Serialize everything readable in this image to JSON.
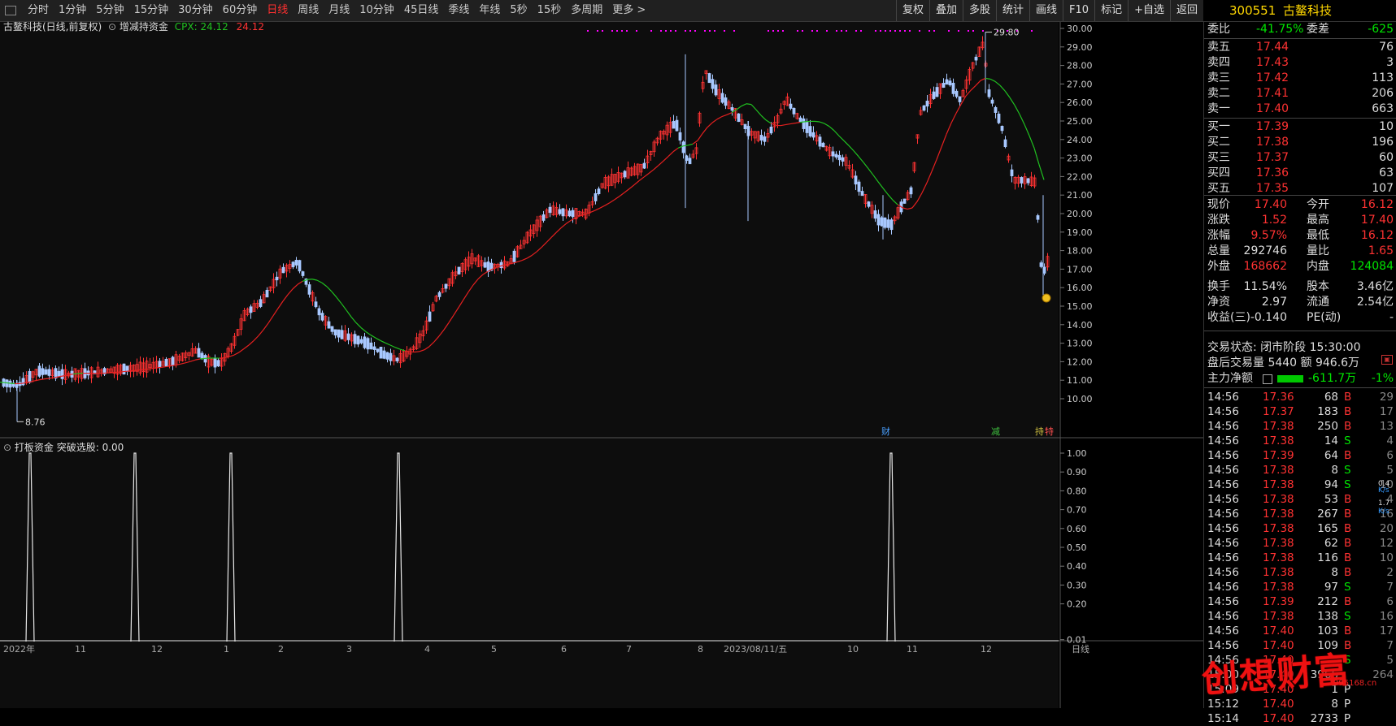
{
  "toolbar": {
    "periods": [
      "分时",
      "1分钟",
      "5分钟",
      "15分钟",
      "30分钟",
      "60分钟",
      "日线",
      "周线",
      "月线",
      "10分钟",
      "45日线",
      "季线",
      "年线",
      "5秒",
      "15秒",
      "多周期",
      "更多 >"
    ],
    "active_period": "日线",
    "tools": [
      "复权",
      "叠加",
      "多股",
      "统计",
      "画线",
      "F10",
      "标记",
      "+自选",
      "返回"
    ]
  },
  "main_pane": {
    "title": "古鳌科技(日线,前复权)",
    "indicator_name": "增减持资金",
    "cpx_label": "CPX: 24.12",
    "cpx_value": "24.12",
    "high_marker": "29.80",
    "low_marker": "8.76",
    "y_ticks": [
      "30.00",
      "29.00",
      "28.00",
      "27.00",
      "26.00",
      "25.00",
      "24.00",
      "23.00",
      "22.00",
      "21.00",
      "20.00",
      "19.00",
      "18.00",
      "17.00",
      "16.00",
      "15.00",
      "14.00",
      "13.00",
      "12.00",
      "11.00",
      "10.00"
    ],
    "event_tags": [
      "财",
      "减",
      "持",
      "特"
    ]
  },
  "sub_pane": {
    "title": "打板资金 突破选股: 0.00",
    "y_ticks": [
      "1.00",
      "0.90",
      "0.80",
      "0.70",
      "0.60",
      "0.50",
      "0.40",
      "0.30",
      "0.20",
      "0.01"
    ],
    "x_axis_labels": [
      "2022年",
      "11",
      "12",
      "1",
      "2",
      "3",
      "4",
      "5",
      "6",
      "7",
      "8",
      "2023/08/11/五",
      "10",
      "11",
      "12",
      "日线"
    ]
  },
  "stock": {
    "code": "300551",
    "name": "古鳌科技"
  },
  "order_book": {
    "weibi_label": "委比",
    "weibi_value": "-41.75%",
    "weicha_label": "委差",
    "weicha_value": "-625",
    "asks": [
      {
        "label": "卖五",
        "price": "17.44",
        "vol": "76"
      },
      {
        "label": "卖四",
        "price": "17.43",
        "vol": "3"
      },
      {
        "label": "卖三",
        "price": "17.42",
        "vol": "113"
      },
      {
        "label": "卖二",
        "price": "17.41",
        "vol": "206"
      },
      {
        "label": "卖一",
        "price": "17.40",
        "vol": "663"
      }
    ],
    "bids": [
      {
        "label": "买一",
        "price": "17.39",
        "vol": "10"
      },
      {
        "label": "买二",
        "price": "17.38",
        "vol": "196"
      },
      {
        "label": "买三",
        "price": "17.37",
        "vol": "60"
      },
      {
        "label": "买四",
        "price": "17.36",
        "vol": "63"
      },
      {
        "label": "买五",
        "price": "17.35",
        "vol": "107"
      }
    ]
  },
  "stats": [
    {
      "l1": "现价",
      "v1": "17.40",
      "c1": "red",
      "l2": "今开",
      "v2": "16.12",
      "c2": "red"
    },
    {
      "l1": "涨跌",
      "v1": "1.52",
      "c1": "red",
      "l2": "最高",
      "v2": "17.40",
      "c2": "red"
    },
    {
      "l1": "涨幅",
      "v1": "9.57%",
      "c1": "red",
      "l2": "最低",
      "v2": "16.12",
      "c2": "red"
    },
    {
      "l1": "总量",
      "v1": "292746",
      "c1": "white",
      "l2": "量比",
      "v2": "1.65",
      "c2": "red"
    },
    {
      "l1": "外盘",
      "v1": "168662",
      "c1": "red",
      "l2": "内盘",
      "v2": "124084",
      "c2": "green"
    },
    {
      "l1": "换手",
      "v1": "11.54%",
      "c1": "white",
      "l2": "股本",
      "v2": "3.46亿",
      "c2": "white"
    },
    {
      "l1": "净资",
      "v1": "2.97",
      "c1": "white",
      "l2": "流通",
      "v2": "2.54亿",
      "c2": "white"
    },
    {
      "l1": "收益(三)",
      "v1": "-0.140",
      "c1": "white",
      "l2": "PE(动)",
      "v2": "-",
      "c2": "white"
    }
  ],
  "status": {
    "trade_state": "交易状态: 闭市阶段 15:30:00",
    "after_hours": "盘后交易量 5440 额 946.6万",
    "main_net_label": "主力净额",
    "main_net_value": "-611.7万",
    "main_net_pct": "-1%"
  },
  "trades": [
    {
      "t": "14:56",
      "p": "17.36",
      "v": "68",
      "d": "B",
      "n": "29"
    },
    {
      "t": "14:56",
      "p": "17.37",
      "v": "183",
      "d": "B",
      "n": "17"
    },
    {
      "t": "14:56",
      "p": "17.38",
      "v": "250",
      "d": "B",
      "n": "13"
    },
    {
      "t": "14:56",
      "p": "17.38",
      "v": "14",
      "d": "S",
      "n": "4"
    },
    {
      "t": "14:56",
      "p": "17.39",
      "v": "64",
      "d": "B",
      "n": "6"
    },
    {
      "t": "14:56",
      "p": "17.38",
      "v": "8",
      "d": "S",
      "n": "5"
    },
    {
      "t": "14:56",
      "p": "17.38",
      "v": "94",
      "d": "S",
      "n": "10"
    },
    {
      "t": "14:56",
      "p": "17.38",
      "v": "53",
      "d": "B",
      "n": "4"
    },
    {
      "t": "14:56",
      "p": "17.38",
      "v": "267",
      "d": "B",
      "n": "16"
    },
    {
      "t": "14:56",
      "p": "17.38",
      "v": "165",
      "d": "B",
      "n": "20"
    },
    {
      "t": "14:56",
      "p": "17.38",
      "v": "62",
      "d": "B",
      "n": "12"
    },
    {
      "t": "14:56",
      "p": "17.38",
      "v": "116",
      "d": "B",
      "n": "10"
    },
    {
      "t": "14:56",
      "p": "17.38",
      "v": "8",
      "d": "B",
      "n": "2"
    },
    {
      "t": "14:56",
      "p": "17.38",
      "v": "97",
      "d": "S",
      "n": "7"
    },
    {
      "t": "14:56",
      "p": "17.39",
      "v": "212",
      "d": "B",
      "n": "6"
    },
    {
      "t": "14:56",
      "p": "17.38",
      "v": "138",
      "d": "S",
      "n": "16"
    },
    {
      "t": "14:56",
      "p": "17.40",
      "v": "103",
      "d": "B",
      "n": "17"
    },
    {
      "t": "14:56",
      "p": "17.40",
      "v": "109",
      "d": "B",
      "n": "7"
    },
    {
      "t": "14:56",
      "p": "17.40",
      "v": "",
      "d": "S",
      "n": "5"
    },
    {
      "t": "15:00",
      "p": "17.40",
      "v": "3966",
      "d": "",
      "n": "264"
    },
    {
      "t": "15:09",
      "p": "17.40",
      "v": "1",
      "d": "P",
      "n": ""
    },
    {
      "t": "15:12",
      "p": "17.40",
      "v": "8",
      "d": "P",
      "n": ""
    },
    {
      "t": "15:14",
      "p": "17.40",
      "v": "2733",
      "d": "P",
      "n": ""
    }
  ],
  "side_readouts": [
    "0.4",
    "1.7",
    "K/s",
    "K/s"
  ],
  "watermark": {
    "text": "创想财富",
    "url": "995168.cn"
  },
  "colors": {
    "up": "#ff3232",
    "down": "#8ab4f8",
    "ma_red": "#e62020",
    "ma_green": "#20c020",
    "signal": "#ff00ff",
    "accent": "#ffd700"
  }
}
